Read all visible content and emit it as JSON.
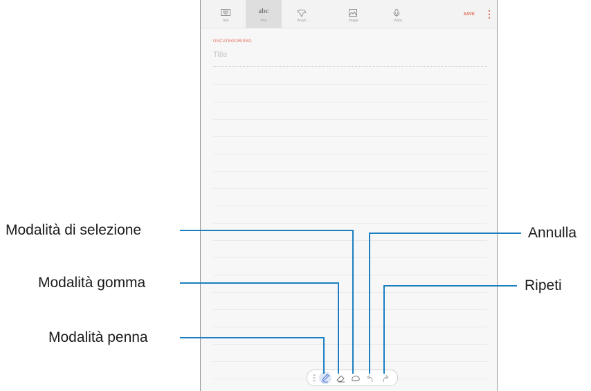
{
  "toolbar": {
    "items": [
      {
        "label": "Text",
        "icon": "keyboard-icon"
      },
      {
        "label": "Pen",
        "glyph": "abc",
        "icon": "pen-mode-icon"
      },
      {
        "label": "Brush",
        "icon": "brush-icon"
      },
      {
        "label": "Image",
        "icon": "image-icon"
      },
      {
        "label": "Voice",
        "icon": "microphone-icon"
      }
    ],
    "save_label": "SAVE",
    "more_icon": "more-vertical-icon"
  },
  "note": {
    "category": "UNCATEGORISED",
    "title_placeholder": "Title"
  },
  "callouts": {
    "selection": "Modalità di selezione",
    "eraser": "Modalità gomma",
    "pen": "Modalità penna",
    "undo": "Annulla",
    "redo": "Ripeti"
  },
  "pen_toolbar": {
    "icons": [
      "drag-handle-icon",
      "pen-icon",
      "eraser-icon",
      "selection-icon",
      "undo-icon",
      "redo-icon"
    ]
  },
  "colors": {
    "accent": "#e0644c",
    "leader": "#1a7fc1",
    "active_pen": "#3d6fd8"
  }
}
